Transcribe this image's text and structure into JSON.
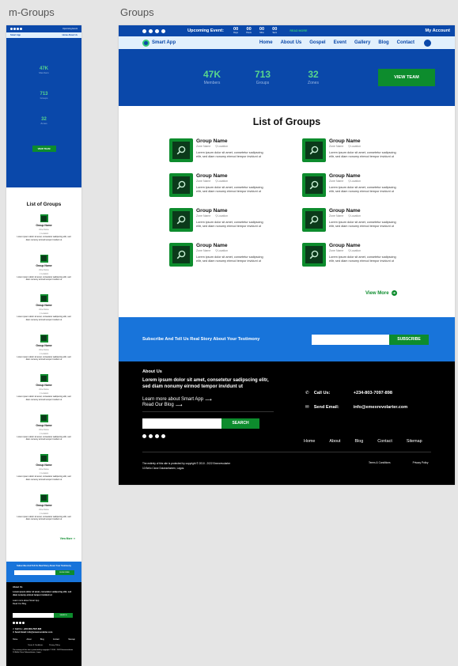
{
  "labels": {
    "mobile": "m-Groups",
    "desktop": "Groups"
  },
  "colors": {
    "primary": "#0a48aa",
    "accent": "#0d8c2d",
    "stat": "#58d58d",
    "subscribe_bg": "#1874da",
    "footer_bg": "#000000"
  },
  "topbar": {
    "event_label": "Upcoming Event:",
    "countdown": [
      {
        "num": "00",
        "label": "Days"
      },
      {
        "num": "00",
        "label": "Hours"
      },
      {
        "num": "00",
        "label": "Mins"
      },
      {
        "num": "00",
        "label": "Secs"
      }
    ],
    "read_more": "READ MORE",
    "account": "My Account",
    "mobile_right": "Upcoming Event"
  },
  "navbar": {
    "logo": "Smart App",
    "items": [
      "Home",
      "About Us",
      "Gospel",
      "Event",
      "Gallery",
      "Blog",
      "Contact"
    ],
    "mobile_items": "Home   About Us"
  },
  "hero": {
    "stats": [
      {
        "num": "47K",
        "label": "Members"
      },
      {
        "num": "713",
        "label": "Groups"
      },
      {
        "num": "32",
        "label": "Zones"
      }
    ],
    "view_team": "VIEW TEAM"
  },
  "groups": {
    "title": "List of Groups",
    "name": "Group Name",
    "zone": "Zone Name",
    "location": "Location",
    "desc": "Lorem ipsum dolor sit amet, consetetur sadipscing elitr, sed diam nonumy eirmod tempor invidunt ut",
    "view_more": "View More"
  },
  "subscribe": {
    "text": "Subscribe And Tell Us Real Story About Your Testimony",
    "button": "SUBSCRIBE"
  },
  "footer": {
    "about_heading": "About Us",
    "about_text": "Lorem ipsum dolor sit amet, consetetur sadipscing elitr, sed diam nonumy eirmod tempor invidunt ut",
    "learn_more": "Learn more about Smart App",
    "read_blog": "Read Our Blog",
    "search_button": "SEARCH",
    "call_label": "Call Us:",
    "call_value": "+234-803-7097-898",
    "email_label": "Send Email:",
    "email_value": "info@emexrevolarter.com",
    "nav": [
      "Home",
      "About",
      "Blog",
      "Contact",
      "Sitemap"
    ],
    "copyright": "The entirety of this site is protected by copyright © 2010 - 2022 Emexrevolarter",
    "address": "10 Bello Close Dolanselamen, Lagos.",
    "terms": "Terms & Conditions",
    "privacy": "Privacy Policy"
  }
}
